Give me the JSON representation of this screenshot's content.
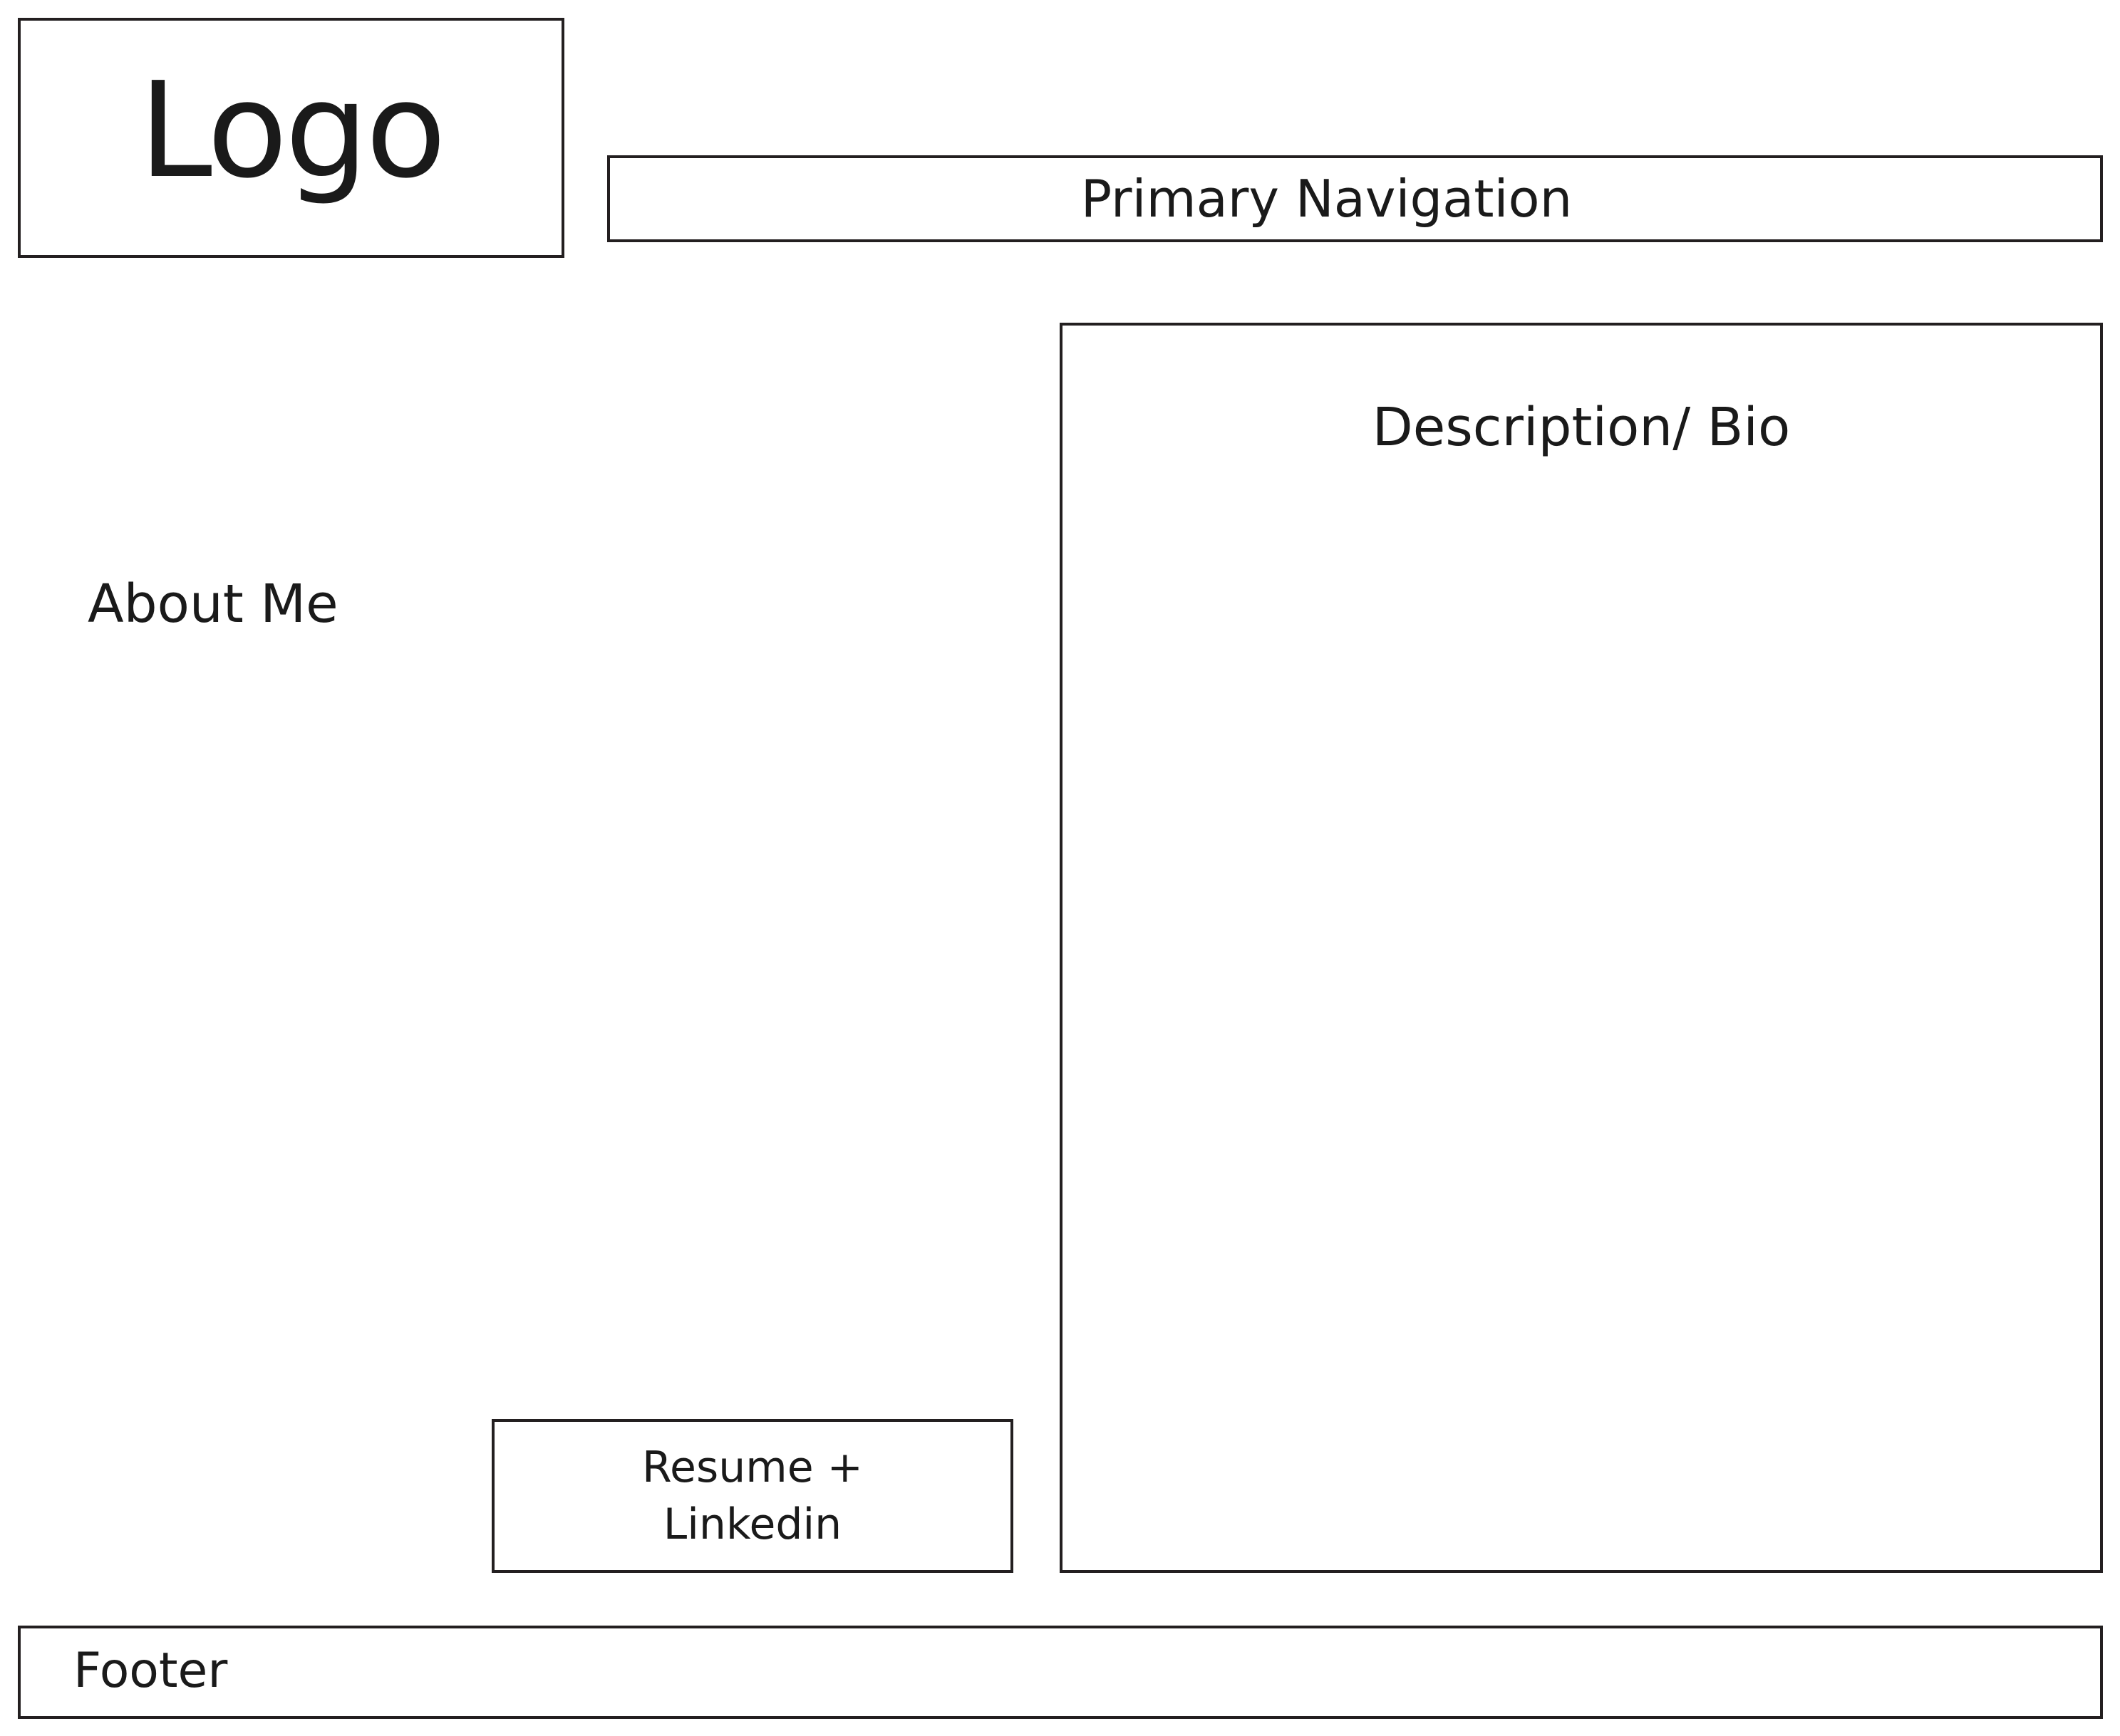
{
  "logo": {
    "label": "Logo"
  },
  "navigation": {
    "label": "Primary Navigation"
  },
  "about": {
    "heading": "About Me"
  },
  "bio": {
    "label": "Description/ Bio"
  },
  "resume": {
    "line1": "Resume +",
    "line2": "Linkedin"
  },
  "footer": {
    "label": "Footer"
  }
}
